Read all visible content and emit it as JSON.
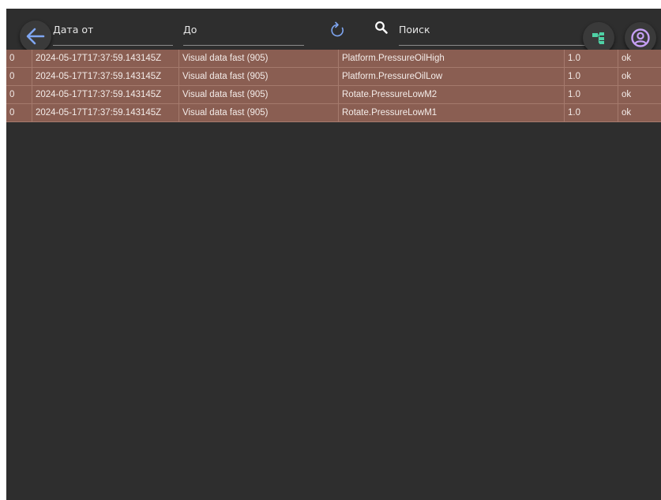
{
  "header": {
    "date_from_placeholder": "Дата от",
    "date_to_placeholder": "До",
    "search_placeholder": "Поиск"
  },
  "icons": {
    "back": "arrow-left-icon",
    "refresh": "refresh-icon",
    "search": "search-icon",
    "tree": "tree-structure-icon",
    "user": "user-account-icon"
  },
  "colors": {
    "background": "#2e2e2e",
    "row_background": "#8a5e52",
    "accent_blue": "#7fa6f2",
    "tree_green": "#4fd1a5",
    "user_purple": "#c59ff5"
  },
  "table": {
    "rows": [
      {
        "id": "0",
        "timestamp": "2024-05-17T17:37:59.143145Z",
        "source": "Visual data fast (905)",
        "tag": "Platform.PressureOilHigh",
        "value": "1.0",
        "status": "ok"
      },
      {
        "id": "0",
        "timestamp": "2024-05-17T17:37:59.143145Z",
        "source": "Visual data fast (905)",
        "tag": "Platform.PressureOilLow",
        "value": "1.0",
        "status": "ok"
      },
      {
        "id": "0",
        "timestamp": "2024-05-17T17:37:59.143145Z",
        "source": "Visual data fast (905)",
        "tag": "Rotate.PressureLowM2",
        "value": "1.0",
        "status": "ok"
      },
      {
        "id": "0",
        "timestamp": "2024-05-17T17:37:59.143145Z",
        "source": "Visual data fast (905)",
        "tag": "Rotate.PressureLowM1",
        "value": "1.0",
        "status": "ok"
      }
    ]
  }
}
